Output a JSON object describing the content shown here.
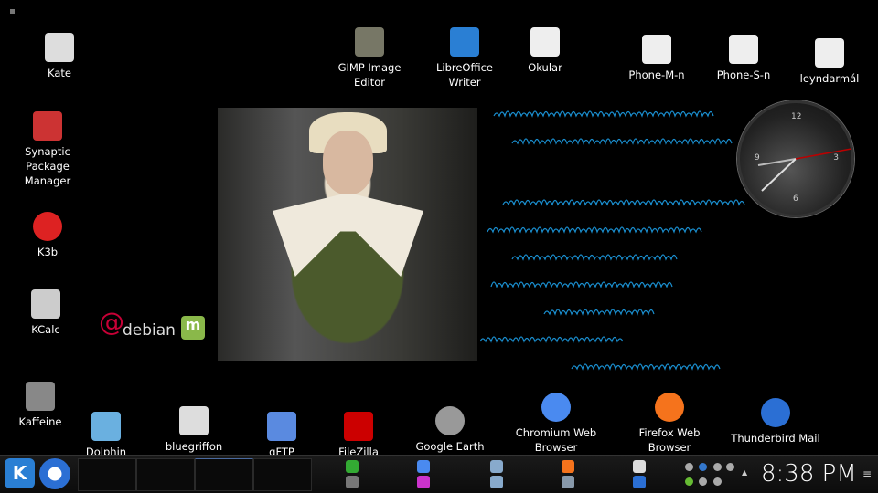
{
  "desktop_icons": [
    {
      "label": "Kate",
      "icon": "kate-icon",
      "color": "#ddd"
    },
    {
      "label": "Synaptic Package Manager",
      "icon": "synaptic-icon",
      "color": "#c33"
    },
    {
      "label": "K3b",
      "icon": "k3b-icon",
      "color": "#d22"
    },
    {
      "label": "KCalc",
      "icon": "kcalc-icon",
      "color": "#ccc"
    },
    {
      "label": "Kaffeine",
      "icon": "kaffeine-icon",
      "color": "#888"
    },
    {
      "label": "GIMP Image Editor",
      "icon": "gimp-icon",
      "color": "#776"
    },
    {
      "label": "LibreOffice Writer",
      "icon": "writer-icon",
      "color": "#2a7fd4"
    },
    {
      "label": "Okular",
      "icon": "okular-icon",
      "color": "#eee"
    },
    {
      "label": "Phone-M-n",
      "icon": "document-icon",
      "color": "#eee"
    },
    {
      "label": "Phone-S-n",
      "icon": "document-icon",
      "color": "#eee"
    },
    {
      "label": "leyndarmál",
      "icon": "document-icon",
      "color": "#eee"
    },
    {
      "label": "Dolphin",
      "icon": "dolphin-icon",
      "color": "#6ab0e0"
    },
    {
      "label": "bluegriffon",
      "icon": "terminal-doc-icon",
      "color": "#ddd"
    },
    {
      "label": "gFTP",
      "icon": "gftp-icon",
      "color": "#5a8ae0"
    },
    {
      "label": "FileZilla",
      "icon": "filezilla-icon",
      "color": "#c00"
    },
    {
      "label": "Google Earth",
      "icon": "google-earth-icon",
      "color": "#999"
    },
    {
      "label": "Chromium Web Browser",
      "icon": "chromium-icon",
      "color": "#4a8af0"
    },
    {
      "label": "Firefox Web Browser",
      "icon": "firefox-icon",
      "color": "#f5731c"
    },
    {
      "label": "Thunderbird Mail",
      "icon": "thunderbird-icon",
      "color": "#2b6fd4"
    }
  ],
  "logos": {
    "debian": "debian",
    "mint": "m"
  },
  "clock_widget": {
    "numerals": [
      "12",
      "3",
      "6",
      "9"
    ]
  },
  "taskbar": {
    "time": "8:38 PM",
    "launchers": [
      "cinnamon-icon",
      "gimp-icon",
      "chromium-icon",
      "okular-icon",
      "writer-icon",
      "calc-icon",
      "firefox-icon",
      "network-icon",
      "kate-icon",
      "thunderbird-icon"
    ],
    "tray": [
      "circle-icon",
      "hp-icon",
      "network-icon",
      "volume-icon",
      "shield-icon",
      "user-icon",
      "scissors-icon"
    ],
    "menu": "≡",
    "expand": "▲"
  }
}
